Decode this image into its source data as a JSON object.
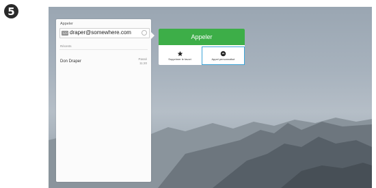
{
  "step_number": "5",
  "panel": {
    "title": "Appeler",
    "search_value": "draper@somewhere.com",
    "keyboard_icon_text": "123",
    "section_label": "Récents",
    "results": [
      {
        "name": "Don Draper",
        "status_line1": "Passé",
        "status_line2": "11:20"
      }
    ]
  },
  "actions": {
    "call_label": "Appeler",
    "favorite_label": "Supprimer le favori",
    "custom_call_label": "Appel personnalisé"
  },
  "colors": {
    "call_green": "#3dae48",
    "focus_blue": "#3ba3d6"
  },
  "icons": {
    "keyboard": "keyboard-icon",
    "clear": "clear-icon",
    "favorite": "star-icon",
    "custom_call": "phone-settings-icon"
  }
}
